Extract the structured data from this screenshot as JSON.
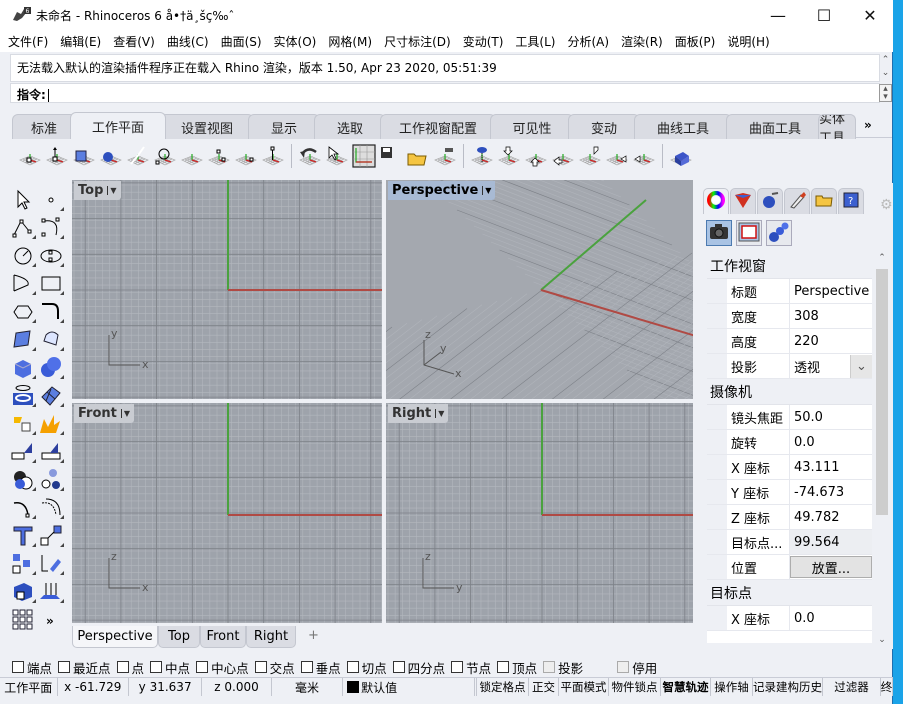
{
  "window": {
    "title": "未命名 - Rhinoceros 6 å•†ä¸šç‰ˆ",
    "controls": {
      "minimize": "—",
      "maximize": "☐",
      "close": "✕"
    }
  },
  "menu": [
    "文件(F)",
    "编辑(E)",
    "查看(V)",
    "曲线(C)",
    "曲面(S)",
    "实体(O)",
    "网格(M)",
    "尺寸标注(D)",
    "变动(T)",
    "工具(L)",
    "分析(A)",
    "渲染(R)",
    "面板(P)",
    "说明(H)"
  ],
  "command": {
    "history": "无法载入默认的渲染插件程序正在载入 Rhino 渲染，版本 1.50, Apr 23 2020, 05:51:39",
    "prompt": "指令:",
    "value": ""
  },
  "toolbar_tabs": {
    "active": 1,
    "items": [
      "标准",
      "工作平面",
      "设置视图",
      "显示",
      "选取",
      "工作视窗配置",
      "可见性",
      "变动",
      "曲线工具",
      "曲面工具",
      "实体工具"
    ],
    "overflow": "»"
  },
  "cplane_tools": [
    {
      "icon": "cplane-origin-icon"
    },
    {
      "icon": "cplane-elevation-icon"
    },
    {
      "icon": "cplane-to-object-icon"
    },
    {
      "icon": "cplane-to-surface-icon"
    },
    {
      "icon": "cplane-perpendicular-to-curve-icon"
    },
    {
      "icon": "cplane-rotate-icon"
    },
    {
      "icon": "cplane-z-axis-icon"
    },
    {
      "icon": "cplane-3-point-icon"
    },
    {
      "icon": "cplane-x-axis-icon"
    },
    {
      "icon": "cplane-vertical-icon"
    },
    {
      "icon": "undo-cplane-icon"
    },
    {
      "icon": "cplane-select-icon"
    },
    {
      "icon": "cplane-world-top-icon"
    },
    {
      "icon": "save-cplane-icon"
    },
    {
      "icon": "open-cplane-icon"
    },
    {
      "icon": "named-cplane-icon"
    },
    {
      "icon": "cplane-to-view-icon"
    },
    {
      "icon": "cplane-world-front-icon"
    },
    {
      "icon": "cplane-world-back-icon"
    },
    {
      "icon": "cplane-world-bottom-icon"
    },
    {
      "icon": "cplane-world-right-icon"
    },
    {
      "icon": "cplane-world-left-icon"
    },
    {
      "icon": "cplane-world-right-2-icon"
    },
    {
      "icon": "cplane-sync-icon"
    }
  ],
  "left_tools": [
    "select-icon",
    "point-icon",
    "polyline-icon",
    "curve-icon",
    "circle-icon",
    "ellipse-icon",
    "arc-icon",
    "rectangle-icon",
    "polygon-icon",
    "fillet-curve-icon",
    "surface-from-points-icon",
    "extrude-surface-icon",
    "box-icon",
    "boolean-union-icon",
    "cylinder-icon",
    "mesh-icon",
    "explode-icon",
    "split-icon",
    "trim-icon",
    "extend-icon",
    "boolean-icon",
    "group-icon",
    "fillet-icon",
    "offset-icon",
    "text-icon",
    "move-icon",
    "array-icon",
    "rotate-icon",
    "block-icon",
    "extrude-up-icon",
    "grid-toolbar-icon",
    "more-tools-icon"
  ],
  "viewports": [
    {
      "name": "Top",
      "axes": [
        "y",
        "x"
      ],
      "active": false
    },
    {
      "name": "Perspective",
      "axes": [
        "z",
        "y",
        "x"
      ],
      "active": true
    },
    {
      "name": "Front",
      "axes": [
        "z",
        "x"
      ],
      "active": false
    },
    {
      "name": "Right",
      "axes": [
        "z",
        "y"
      ],
      "active": false
    }
  ],
  "viewport_tabs": {
    "items": [
      "Perspective",
      "Top",
      "Front",
      "Right"
    ],
    "active": 0,
    "add": "+"
  },
  "osnap": [
    {
      "label": "端点",
      "checked": false,
      "enabled": true
    },
    {
      "label": "最近点",
      "checked": false,
      "enabled": true
    },
    {
      "label": "点",
      "checked": false,
      "enabled": true
    },
    {
      "label": "中点",
      "checked": false,
      "enabled": true
    },
    {
      "label": "中心点",
      "checked": false,
      "enabled": true
    },
    {
      "label": "交点",
      "checked": false,
      "enabled": true
    },
    {
      "label": "垂点",
      "checked": false,
      "enabled": true
    },
    {
      "label": "切点",
      "checked": false,
      "enabled": true
    },
    {
      "label": "四分点",
      "checked": false,
      "enabled": true
    },
    {
      "label": "节点",
      "checked": false,
      "enabled": true
    },
    {
      "label": "顶点",
      "checked": false,
      "enabled": true
    },
    {
      "label": "投影",
      "checked": false,
      "enabled": false
    },
    {
      "label": "停用",
      "checked": false,
      "enabled": false
    }
  ],
  "status": {
    "cplane": "工作平面",
    "x": "x -61.729",
    "y": "y 31.637",
    "z": "z 0.000",
    "units": "毫米",
    "layer": "默认值",
    "layer_color": "#000000",
    "toggles": [
      "锁定格点",
      "正交",
      "平面模式",
      "物件锁点",
      "智慧轨迹",
      "操作轴",
      "记录建构历史",
      "过滤器",
      "终"
    ]
  },
  "panel": {
    "tabs": [
      "color-wheel-icon",
      "material-icon",
      "render-icon",
      "brush-icon",
      "folder-icon",
      "help-icon"
    ],
    "subtabs": [
      "camera-icon",
      "viewport-frame-icon",
      "spheres-icon"
    ],
    "sections": [
      {
        "title": "工作视窗",
        "rows": [
          {
            "key": "标题",
            "value": "Perspective"
          },
          {
            "key": "宽度",
            "value": "308"
          },
          {
            "key": "高度",
            "value": "220"
          },
          {
            "key": "投影",
            "value": "透视",
            "dropdown": true
          }
        ]
      },
      {
        "title": "摄像机",
        "rows": [
          {
            "key": "镜头焦距",
            "value": "50.0"
          },
          {
            "key": "旋转",
            "value": "0.0"
          },
          {
            "key": "X 座标",
            "value": "43.111"
          },
          {
            "key": "Y 座标",
            "value": "-74.673"
          },
          {
            "key": "Z 座标",
            "value": "49.782"
          },
          {
            "key": "目标点...",
            "value": "99.564"
          },
          {
            "key": "位置",
            "button": "放置..."
          }
        ]
      },
      {
        "title": "目标点",
        "rows": [
          {
            "key": "X 座标",
            "value": "0.0"
          }
        ]
      }
    ]
  },
  "colors": {
    "x_axis": "#b04a44",
    "y_axis": "#4aa23e",
    "viewport_bg": "#9ea3ab",
    "active_label": "#a8bad4"
  }
}
